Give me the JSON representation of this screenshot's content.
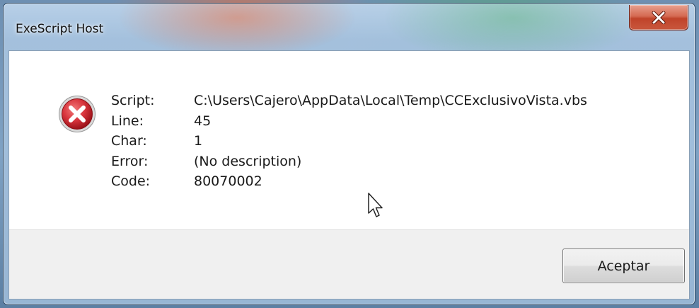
{
  "window": {
    "title": "ExeScript Host"
  },
  "titlebar": {
    "close_icon": "close-icon"
  },
  "message": {
    "icon": "error-icon",
    "rows": [
      {
        "label": "Script:",
        "value": "C:\\Users\\Cajero\\AppData\\Local\\Temp\\CCExclusivoVista.vbs"
      },
      {
        "label": "Line:",
        "value": "45"
      },
      {
        "label": "Char:",
        "value": "1"
      },
      {
        "label": "Error:",
        "value": "(No description)"
      },
      {
        "label": "Code:",
        "value": "80070002"
      }
    ]
  },
  "buttons": {
    "ok_label": "Aceptar"
  },
  "colors": {
    "error_red": "#c4232e",
    "close_red": "#c9472e",
    "footer_bg": "#f0f0f0"
  }
}
